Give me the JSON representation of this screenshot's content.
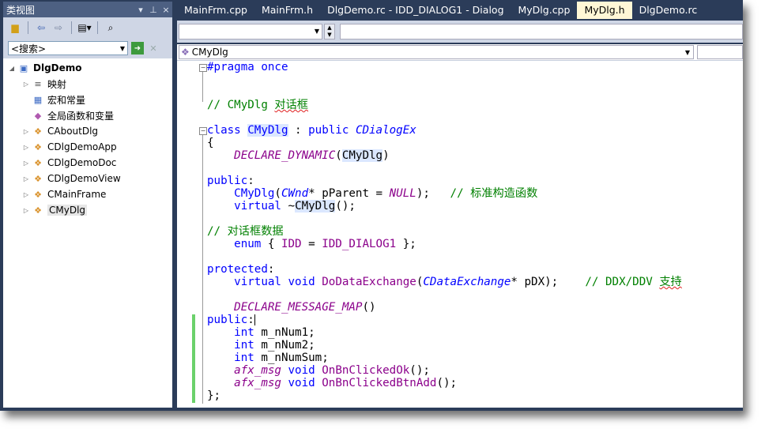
{
  "class_view": {
    "title": "类视图",
    "pin": "▾ ⊿",
    "close": "×",
    "search_placeholder": "<搜索>",
    "tree": [
      {
        "label": "DlgDemo",
        "level": 0,
        "expander": "◢",
        "icon": "project-icon",
        "bold": true
      },
      {
        "label": "映射",
        "level": 1,
        "expander": "▷",
        "icon": "map-icon"
      },
      {
        "label": "宏和常量",
        "level": 1,
        "expander": "",
        "icon": "macro-icon"
      },
      {
        "label": "全局函数和变量",
        "level": 1,
        "expander": "",
        "icon": "global-icon"
      },
      {
        "label": "CAboutDlg",
        "level": 1,
        "expander": "▷",
        "icon": "class-icon"
      },
      {
        "label": "CDlgDemoApp",
        "level": 1,
        "expander": "▷",
        "icon": "class-icon"
      },
      {
        "label": "CDlgDemoDoc",
        "level": 1,
        "expander": "▷",
        "icon": "class-icon"
      },
      {
        "label": "CDlgDemoView",
        "level": 1,
        "expander": "▷",
        "icon": "class-icon"
      },
      {
        "label": "CMainFrame",
        "level": 1,
        "expander": "▷",
        "icon": "class-icon"
      },
      {
        "label": "CMyDlg",
        "level": 1,
        "expander": "▷",
        "icon": "class-icon",
        "selected": true
      }
    ]
  },
  "tabs": [
    {
      "label": "MainFrm.cpp",
      "active": false
    },
    {
      "label": "MainFrm.h",
      "active": false
    },
    {
      "label": "DlgDemo.rc - IDD_DIALOG1 - Dialog",
      "active": false
    },
    {
      "label": "MyDlg.cpp",
      "active": false
    },
    {
      "label": "MyDlg.h",
      "active": true
    },
    {
      "label": "DlgDemo.rc",
      "active": false
    }
  ],
  "nav": {
    "class_combo": "CMyDlg"
  },
  "code_lines": [
    "<span class='kw'>#pragma</span> <span class='kw'>once</span>",
    "",
    "",
    "<span class='cm'>// CMyDlg <span class='squig'>对话框</span></span>",
    "",
    "<span class='kw'>class</span> <span class='hl ty' style='font-style:normal'>CMyDlg</span> : <span class='kw'>public</span> <span class='ty'>CDialogEx</span>",
    "{",
    "    <span class='mc'>DECLARE_DYNAMIC</span>(<span class='hl'>CMyDlg</span>)",
    "",
    "<span class='kw'>public</span>:",
    "    <span class='kw'>CMyDlg</span>(<span class='ty'>CWnd</span>* pParent = <span class='mc'>NULL</span>);   <span class='cm'>// 标准构造函数</span>",
    "    <span class='kw'>virtual</span> ~<span class='hl'>CMyDlg</span>();",
    "",
    "<span class='cm'>// 对话框数据</span>",
    "    <span class='kw'>enum</span> { <span class='mc' style='font-style:normal'>IDD</span> = <span class='mc' style='font-style:normal'>IDD_DIALOG1</span> };",
    "",
    "<span class='kw'>protected</span>:",
    "    <span class='kw'>virtual</span> <span class='kw'>void</span> <span class='mc' style='font-style:normal'>DoDataExchange</span>(<span class='ty'>CDataExchange</span>* pDX);    <span class='cm'>// DDX/DDV <span class='squig'>支持</span></span>",
    "",
    "    <span class='mc'>DECLARE_MESSAGE_MAP</span>()",
    "<span class='kw'>public</span>:<span class='caret'></span>",
    "    <span class='kw'>int</span> m_nNum1;",
    "    <span class='kw'>int</span> m_nNum2;",
    "    <span class='kw'>int</span> m_nNumSum;",
    "    <span class='mc'>afx_msg</span> <span class='kw'>void</span> <span class='mc' style='font-style:normal'>OnBnClickedOk</span>();",
    "    <span class='mc'>afx_msg</span> <span class='kw'>void</span> <span class='mc' style='font-style:normal'>OnBnClickedBtnAdd</span>();",
    "};"
  ]
}
